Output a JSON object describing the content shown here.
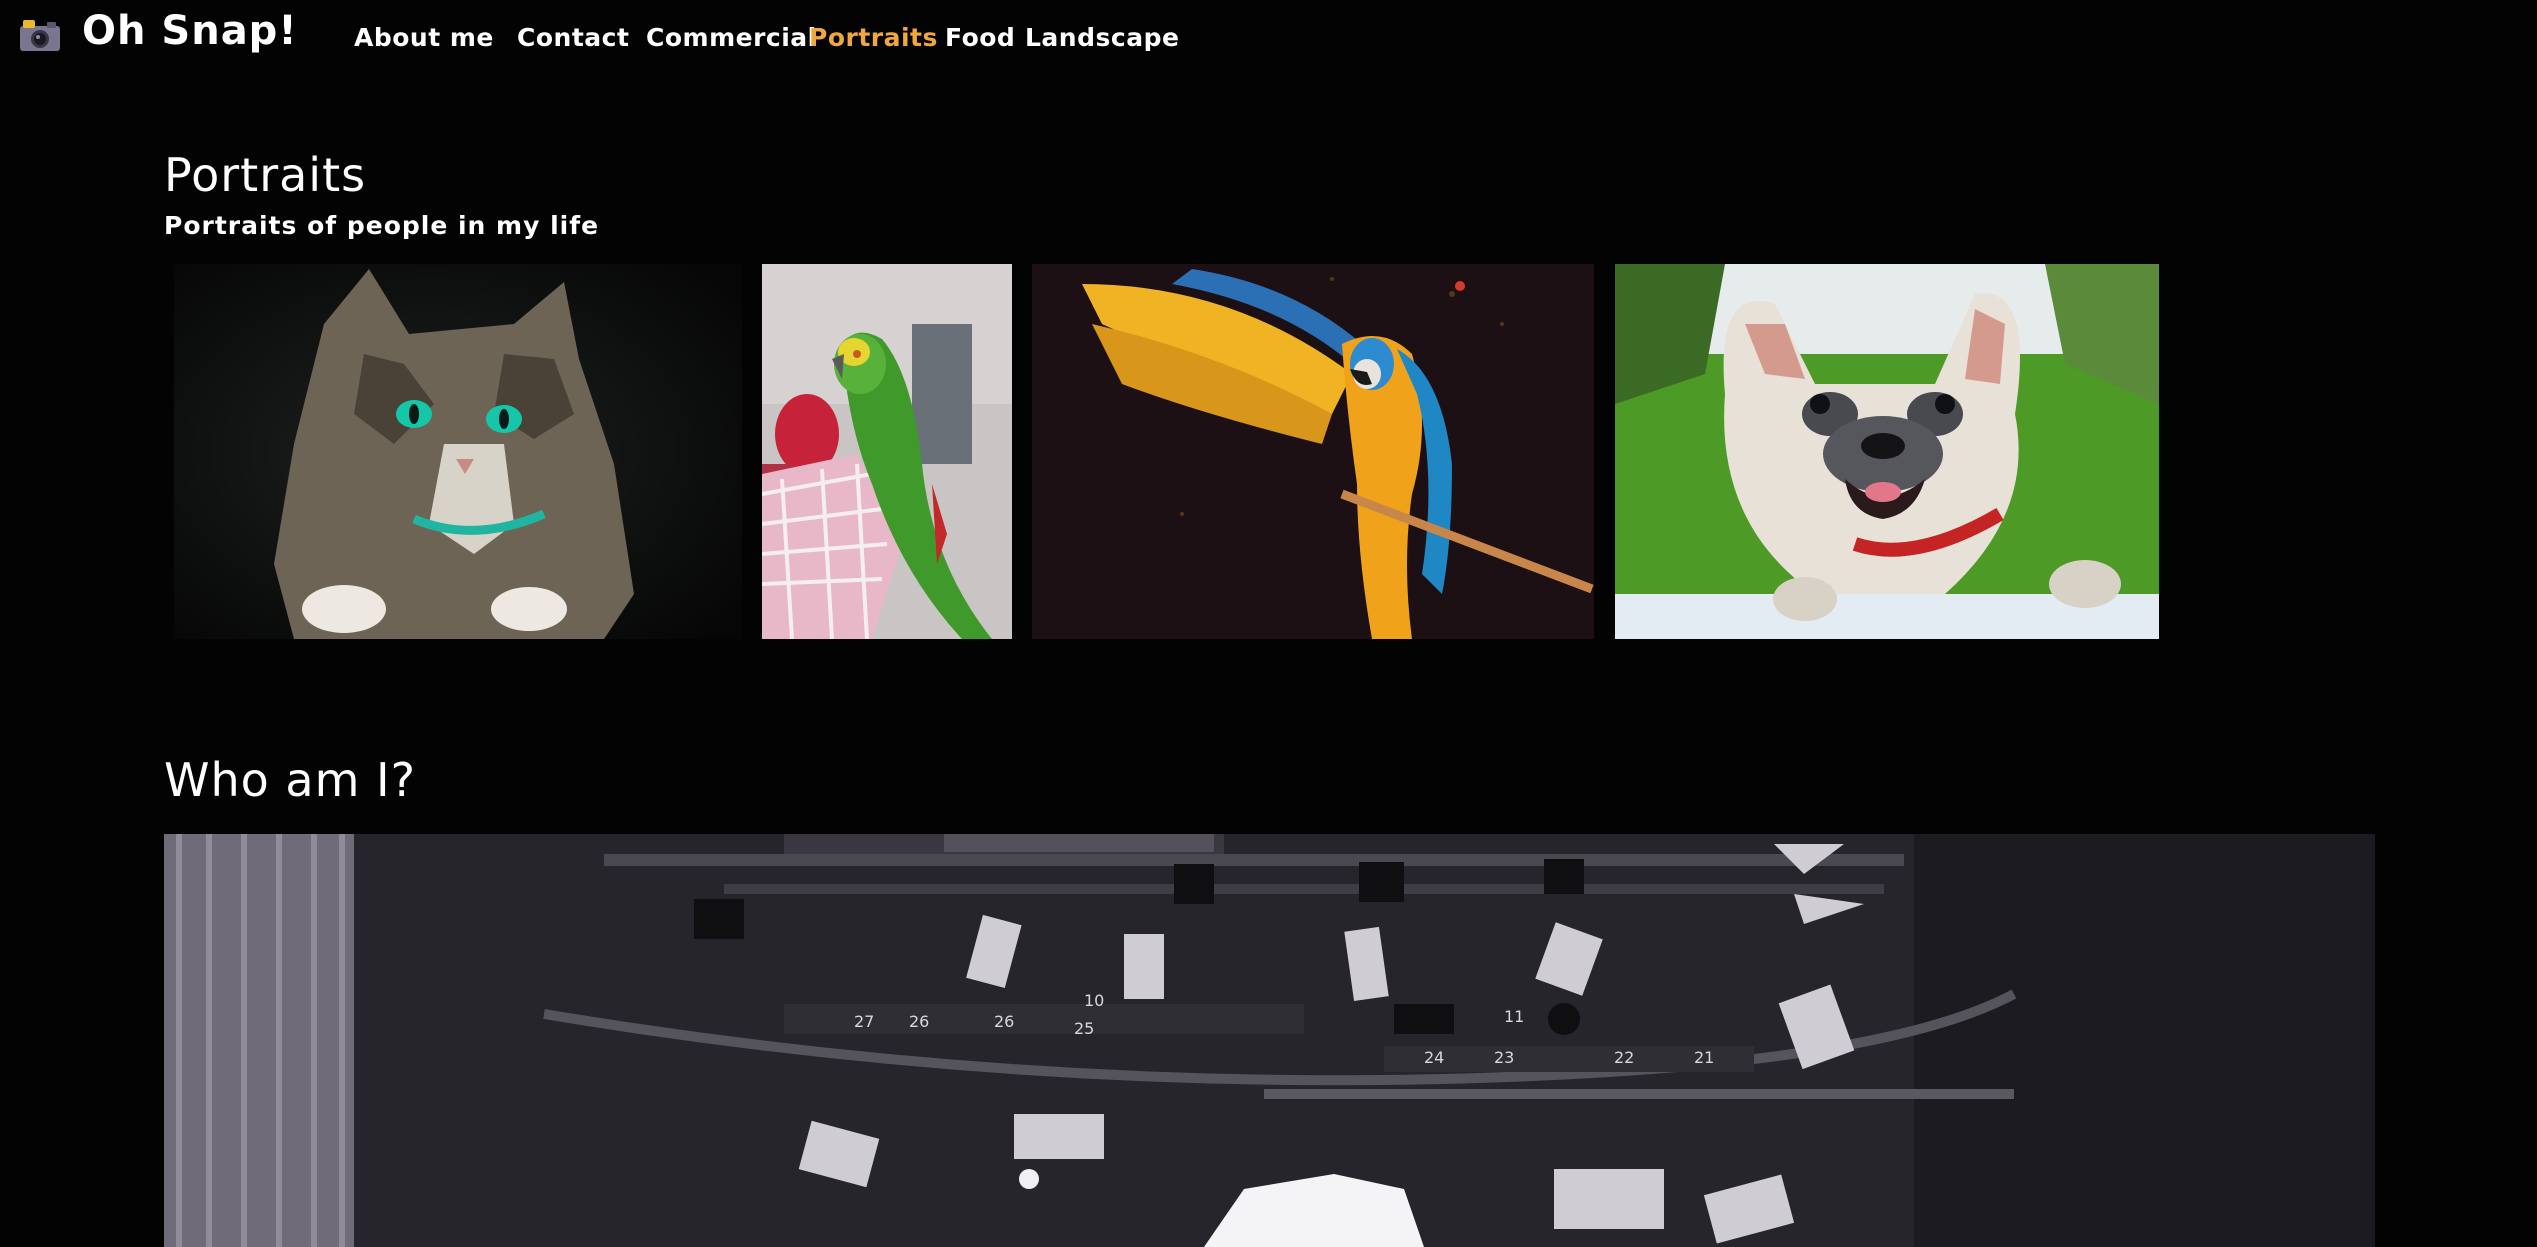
{
  "site": {
    "name": "Oh Snap!",
    "logo_icon": "camera-icon"
  },
  "nav": {
    "items": [
      {
        "label": "About me",
        "active": false
      },
      {
        "label": "Contact",
        "active": false
      },
      {
        "label": "Commercial",
        "active": false
      },
      {
        "label": "Portraits",
        "active": true
      },
      {
        "label": "Food",
        "active": false
      },
      {
        "label": "Landscape",
        "active": false
      }
    ],
    "active_color": "#f0a73e"
  },
  "portraits": {
    "title": "Portraits",
    "subtitle": "Portraits of people in my life",
    "photos": [
      {
        "subject": "tabby cat with green eyes"
      },
      {
        "subject": "green parrot on cage"
      },
      {
        "subject": "blue-and-gold macaw on branch"
      },
      {
        "subject": "french bulldog"
      }
    ]
  },
  "about": {
    "title": "Who am I?",
    "banner_subject": "photo studio lighting rig"
  },
  "colors": {
    "background": "#030303",
    "text": "#ffffff",
    "accent": "#f0a73e"
  }
}
